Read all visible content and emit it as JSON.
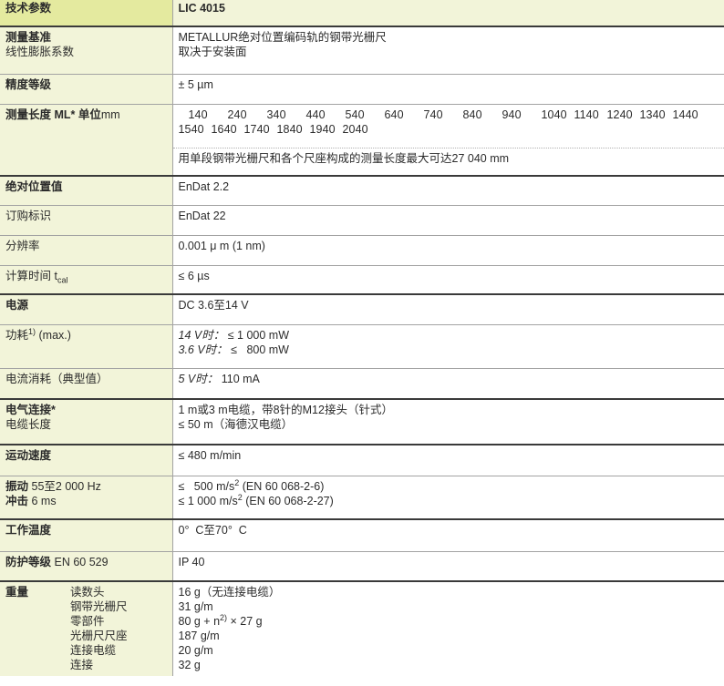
{
  "header": {
    "label": "技术参数",
    "model": "LIC 4015"
  },
  "ref": {
    "label1": "测量基准",
    "label2": "线性膨胀系数",
    "value1": "METALLUR绝对位置编码轨的钢带光栅尺",
    "value2": "取决于安装面"
  },
  "accuracy": {
    "label": "精度等级",
    "value": "± 5 µm"
  },
  "length": {
    "label_bold": "测量长度 ML* 单位",
    "label_unit": "mm",
    "row1": [
      "140",
      "240",
      "340",
      "440",
      "540",
      "640",
      "740",
      "840",
      "940",
      "1040",
      "1140",
      "1240",
      "1340",
      "1440"
    ],
    "row2": [
      "1540",
      "1640",
      "1740",
      "1840",
      "1940",
      "2040"
    ],
    "note": "用单段钢带光栅尺和各个尺座构成的测量长度最大可达27 040 mm"
  },
  "abs": {
    "label": "绝对位置值",
    "value": "EnDat 2.2"
  },
  "order": {
    "label": "订购标识",
    "value": "EnDat 22"
  },
  "resolution": {
    "label": "分辨率",
    "value": "0.001 μ m (1 nm)"
  },
  "calc": {
    "label": "计算时间 t",
    "sub": "cal",
    "value": "≤ 6 µs"
  },
  "power": {
    "label": "电源",
    "value": "DC 3.6至14 V"
  },
  "consumption": {
    "label": "功耗",
    "sup": "1)",
    "label_tail": " (max.)",
    "line1_cond": "14 V时：",
    "line1_val": " ≤ 1 000 mW",
    "line2_cond": "3.6 V时：",
    "line2_val": " ≤   800 mW"
  },
  "current": {
    "label": "电流消耗（典型值）",
    "cond": "5 V时：",
    "value": " 110 mA"
  },
  "electrical": {
    "label1": "电气连接*",
    "label2": "电缆长度",
    "value1": "1 m或3 m电缆，带8针的M12接头（针式）",
    "value2": "≤ 50 m（海德汉电缆）"
  },
  "speed": {
    "label": "运动速度",
    "value": "≤ 480 m/min"
  },
  "vibration": {
    "label1_bold": "振动",
    "label1_rest": " 55至2 000 Hz",
    "label2_bold": "冲击",
    "label2_rest": " 6 ms",
    "v1_pre": "≤   500 m/s",
    "v1_sup": "2",
    "v1_post": " (EN 60 068-2-6)",
    "v2_pre": "≤ 1 000 m/s",
    "v2_sup": "2",
    "v2_post": " (EN 60 068-2-27)"
  },
  "temp": {
    "label": "工作温度",
    "value": "0°  C至70°  C"
  },
  "protection": {
    "label_bold": "防护等级",
    "label_rest": " EN 60 529",
    "value": "IP 40"
  },
  "weight": {
    "label": "重量",
    "items": [
      "读数头",
      "钢带光栅尺",
      "零部件",
      "光栅尺尺座",
      "连接电缆",
      "连接"
    ],
    "values": [
      "16 g（无连接电缆）",
      "31 g/m",
      "",
      "187 g/m",
      "20 g/m",
      "32 g"
    ],
    "parts_pre": "80 g + n",
    "parts_sup": "2)",
    "parts_post": " × 27 g"
  }
}
